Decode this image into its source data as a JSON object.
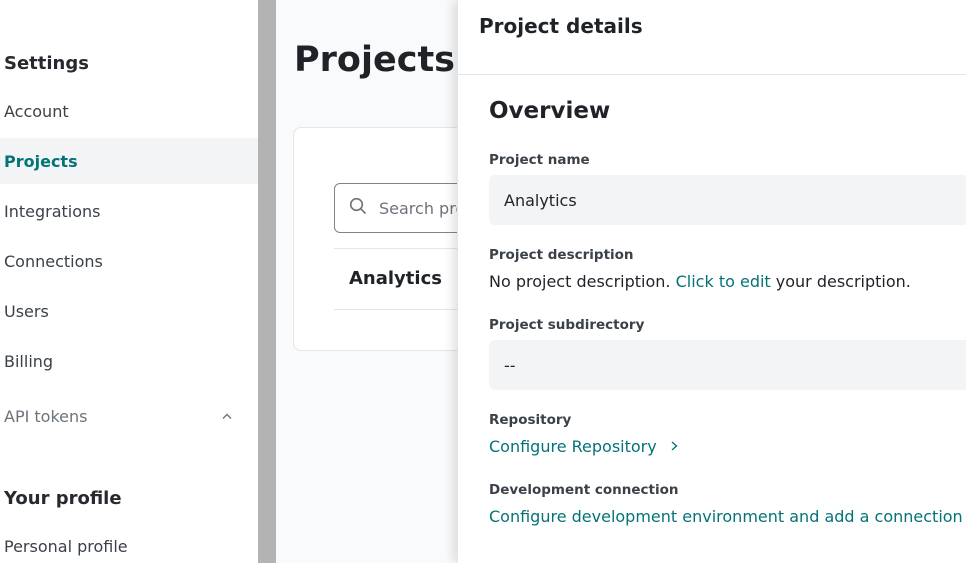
{
  "sidebar": {
    "settings_heading": "Settings",
    "items": [
      {
        "label": "Account"
      },
      {
        "label": "Projects"
      },
      {
        "label": "Integrations"
      },
      {
        "label": "Connections"
      },
      {
        "label": "Users"
      },
      {
        "label": "Billing"
      },
      {
        "label": "API tokens"
      }
    ],
    "profile_heading": "Your profile",
    "profile_items": [
      {
        "label": "Personal profile"
      }
    ]
  },
  "main": {
    "title": "Projects",
    "search_placeholder": "Search projects",
    "projects": [
      {
        "name": "Analytics"
      }
    ]
  },
  "panel": {
    "title": "Project details",
    "section": "Overview",
    "project_name_label": "Project name",
    "project_name_value": "Analytics",
    "description_label": "Project description",
    "description_prefix": "No project description.",
    "description_link": "Click to edit",
    "description_suffix": "your description.",
    "subdirectory_label": "Project subdirectory",
    "subdirectory_value": "--",
    "repository_label": "Repository",
    "repository_link": "Configure Repository",
    "dev_connection_label": "Development connection",
    "dev_connection_link": "Configure development environment and add a connection"
  },
  "colors": {
    "accent": "#047377",
    "active_bg": "#f3f4f5",
    "gutter": "#b3b3b3"
  },
  "icons": {
    "search": "search-icon",
    "chevron_up": "chevron-up-icon",
    "chevron_right": "chevron-right-icon"
  }
}
